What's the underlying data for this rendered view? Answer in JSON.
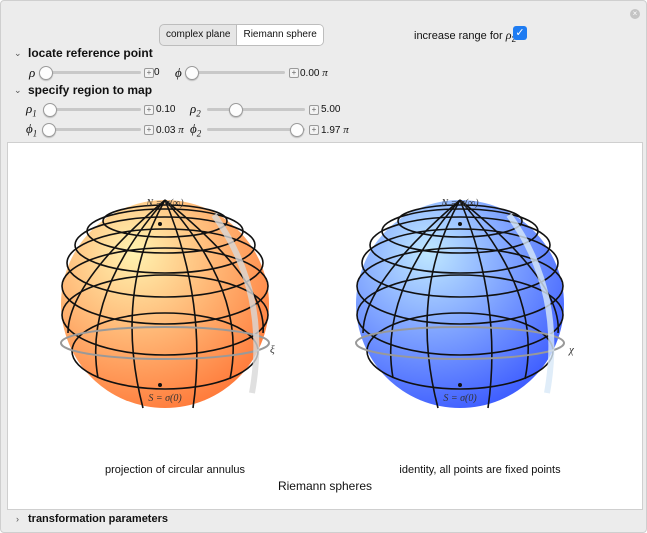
{
  "tabs": {
    "option1": "complex plane",
    "option2": "Riemann sphere"
  },
  "range_toggle": {
    "label": "increase range for",
    "symbol": "ρ",
    "sub": "2",
    "checked": true
  },
  "close": {
    "glyph": "×"
  },
  "section_reference": {
    "title": "locate reference point"
  },
  "rho": {
    "symbol": "ρ",
    "value": "0",
    "level": 0
  },
  "phi": {
    "symbol": "ϕ",
    "value": "0.00",
    "unit": "π",
    "level": 0
  },
  "section_region": {
    "title": "specify region to map"
  },
  "rho1": {
    "symbol": "ρ",
    "sub": "1",
    "value": "0.10",
    "level": 0.02
  },
  "rho2": {
    "symbol": "ρ",
    "sub": "2",
    "value": "5.00",
    "level": 0.28
  },
  "phi1": {
    "symbol": "ϕ",
    "sub": "1",
    "value": "0.03",
    "unit": "π",
    "level": 0.01
  },
  "phi2": {
    "symbol": "ϕ",
    "sub": "2",
    "value": "1.97",
    "unit": "π",
    "level": 0.985
  },
  "plot": {
    "north_label": "N = σ(∞)",
    "south_label": "S = σ(0)",
    "left_axis": "ξ",
    "right_axis": "χ",
    "left_caption": "projection of circular annulus",
    "right_caption": "identity, all points are fixed points",
    "title": "Riemann spheres",
    "colors": {
      "left_light": "#fff3b0",
      "left_dark": "#ff7a3a",
      "right_light": "#bfe8ff",
      "right_dark": "#3d5cff"
    }
  },
  "section_transform": {
    "title": "transformation parameters"
  }
}
